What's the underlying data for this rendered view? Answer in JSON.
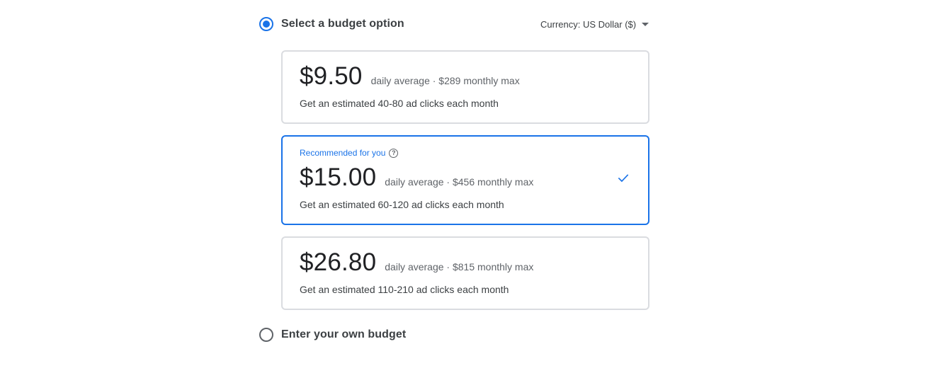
{
  "budget_option": {
    "label": "Select a budget option",
    "selected": true
  },
  "currency": {
    "label": "Currency: US Dollar ($)",
    "icon": "dropdown-caret-icon"
  },
  "options": [
    {
      "price": "$9.50",
      "detail": "daily average · $289 monthly max",
      "estimate": "Get an estimated 40-80 ad clicks each month",
      "selected": false
    },
    {
      "recommended": "Recommended for you",
      "help_icon": "help-icon",
      "price": "$15.00",
      "detail": "daily average · $456 monthly max",
      "estimate": "Get an estimated 60-120 ad clicks each month",
      "selected": true,
      "check_icon": "checkmark-icon"
    },
    {
      "price": "$26.80",
      "detail": "daily average · $815 monthly max",
      "estimate": "Get an estimated 110-210 ad clicks each month",
      "selected": false
    }
  ],
  "own_budget": {
    "label": "Enter your own budget",
    "selected": false
  },
  "colors": {
    "accent": "#1a73e8",
    "border": "#dadce0",
    "text": "#202124",
    "secondary_text": "#5f6368"
  }
}
